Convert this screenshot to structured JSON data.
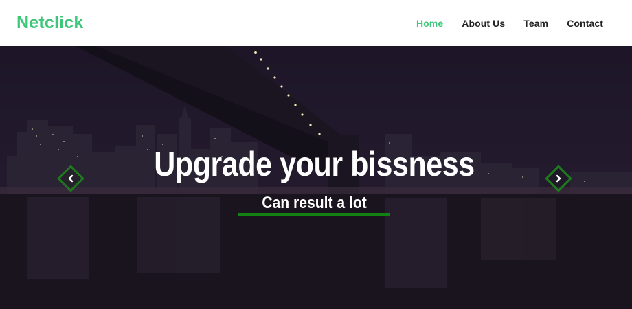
{
  "brand": {
    "name": "Netclick"
  },
  "nav": {
    "items": [
      {
        "label": "Home",
        "active": true
      },
      {
        "label": "About Us",
        "active": false
      },
      {
        "label": "Team",
        "active": false
      },
      {
        "label": "Contact",
        "active": false
      }
    ]
  },
  "hero": {
    "title": "Upgrade your bissness",
    "subtitle": "Can result a lot",
    "prev_icon": "chevron-left-icon",
    "next_icon": "chevron-right-icon"
  },
  "colors": {
    "accent": "#3ec77b",
    "underline": "#128212",
    "arrow_border": "#1f7a1f"
  }
}
